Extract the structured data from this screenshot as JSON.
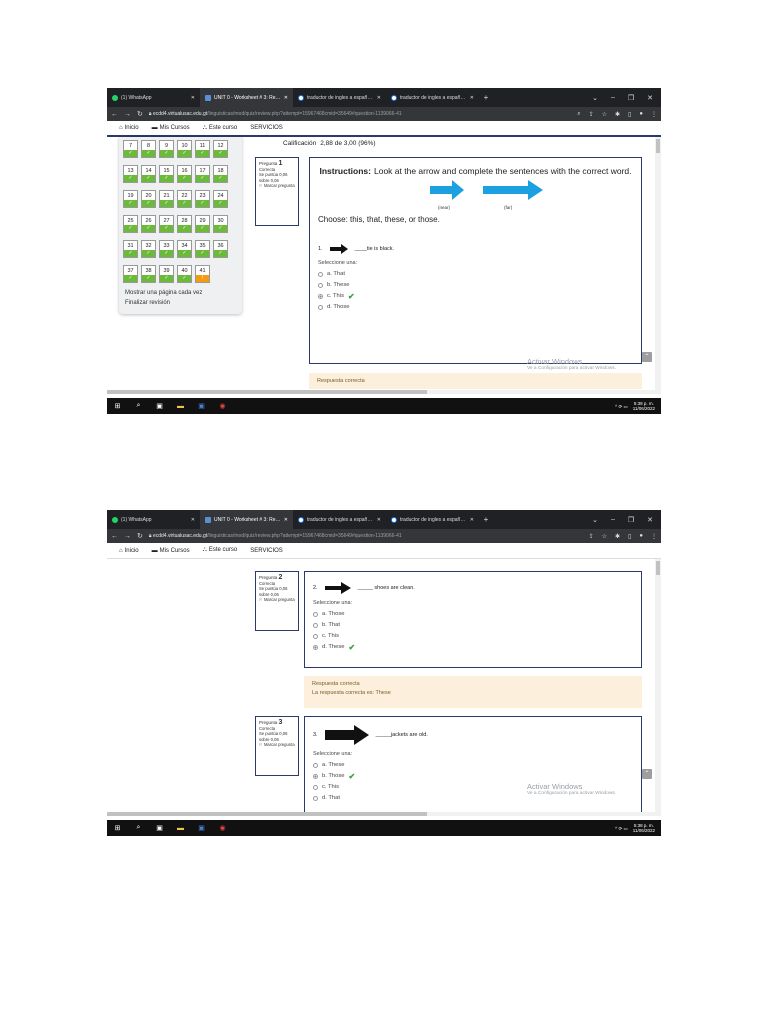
{
  "browser": {
    "tabs": [
      {
        "title": "(1) WhatsApp",
        "icon": "whatsapp-icon"
      },
      {
        "title": "UNIT 0 - Worksheet # 3: Revisió",
        "icon": "university-icon"
      },
      {
        "title": "traductor de ingles a español - (",
        "icon": "google-icon"
      },
      {
        "title": "traductor de ingles a español - (",
        "icon": "google-icon"
      }
    ],
    "new_tab": "+",
    "url_host": "ecdd4.virtualusac.edu.gt",
    "url_path": "/linguisticas/mod/quiz/review.php?attempt=15967468cmid=35649#question-1139066-41",
    "url_path_2": "/linguisticas/mod/quiz/review.php?attempt=15967468cmid=35649#question-1139066-41"
  },
  "sitenav": {
    "inicio": "Inicio",
    "mis_cursos": "Mis Cursos",
    "este_curso": "Este curso",
    "servicios": "SERVICIOS"
  },
  "quiz_nav": {
    "rows": [
      {
        "nums": [
          "7",
          "8",
          "9",
          "10",
          "11",
          "12"
        ],
        "status": [
          "✓",
          "✓",
          "✓",
          "✓",
          "✓",
          "✓"
        ]
      },
      {
        "nums": [
          "13",
          "14",
          "15",
          "16",
          "17",
          "18"
        ],
        "status": [
          "✓",
          "✓",
          "✓",
          "✓",
          "✓",
          "✓"
        ]
      },
      {
        "nums": [
          "19",
          "20",
          "21",
          "22",
          "23",
          "24"
        ],
        "status": [
          "✓",
          "✓",
          "✓",
          "✓",
          "✓",
          "✓"
        ]
      },
      {
        "nums": [
          "25",
          "26",
          "27",
          "28",
          "29",
          "30"
        ],
        "status": [
          "✓",
          "✓",
          "✓",
          "✓",
          "✓",
          "✓"
        ]
      },
      {
        "nums": [
          "31",
          "32",
          "33",
          "34",
          "35",
          "36"
        ],
        "status": [
          "✓",
          "✓",
          "✓",
          "✓",
          "✓",
          "✓"
        ]
      },
      {
        "nums": [
          "37",
          "38",
          "39",
          "40",
          "41"
        ],
        "status": [
          "✓",
          "✓",
          "✓",
          "✓",
          "!"
        ]
      }
    ],
    "show_one_page": "Mostrar una página cada vez",
    "finish_review": "Finalizar revisión"
  },
  "grade": {
    "label": "Calificación",
    "value": "2,88 de 3,00 (96%)"
  },
  "question1": {
    "info_label": "Pregunta",
    "number": "1",
    "state": "Correcta",
    "points": "Se puntúa 0,06 sobre 0,06",
    "flag": "Marcar pregunta",
    "instructions_bold": "Instructions:",
    "instructions": "Look at the arrow and complete the sentences with the correct word.",
    "near_label": "(near)",
    "far_label": "(far)",
    "choose": "Choose:  this, that, these, or those.",
    "prompt_num": "1.",
    "prompt": "____tie is black.",
    "select_label": "Seleccione una:",
    "options": [
      "a. That",
      "b. These",
      "c. This",
      "d. Those"
    ],
    "feedback": "Respuesta correcta"
  },
  "question2": {
    "info_label": "Pregunta",
    "number": "2",
    "state": "Correcta",
    "points": "Se puntúa 0,06 sobre 0,06",
    "flag": "Marcar pregunta",
    "prompt_num": "2.",
    "prompt": "_____ shoes are clean.",
    "select_label": "Seleccione una:",
    "options": [
      "a. Those",
      "b. That",
      "c. This",
      "d. These"
    ],
    "feedback_title": "Respuesta correcta",
    "feedback_answer": "La respuesta correcta es: These"
  },
  "question3": {
    "info_label": "Pregunta",
    "number": "3",
    "state": "Correcta",
    "points": "Se puntúa 0,06 sobre 0,06",
    "flag": "Marcar pregunta",
    "prompt_num": "3.",
    "prompt": "_____jackets are old.",
    "select_label": "Seleccione una:",
    "options": [
      "a. These",
      "b. Those",
      "c. This",
      "d. That"
    ]
  },
  "watermark": {
    "title": "Activar Windows",
    "sub": "Ve a Configuración para activar Windows."
  },
  "taskbar": {
    "time": "5:38 p. m.",
    "date": "11/06/2022",
    "time_2": "5:38 p. m.",
    "date_2": "11/06/2022"
  },
  "colors": {
    "accent": "#2b3a6b",
    "correct": "#6cba3a",
    "flagged": "#f39c12",
    "arrow_blue": "#1ba1e2",
    "feedback_bg": "#fcefdc"
  }
}
